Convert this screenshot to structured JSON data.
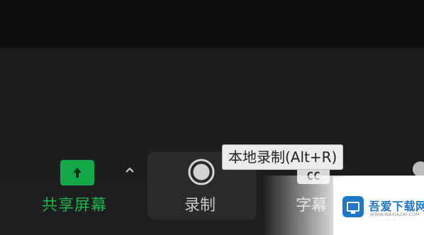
{
  "toolbar": {
    "share_screen": {
      "label": "共享屏幕",
      "icon": "arrow-up-icon",
      "accent": "#13a948"
    },
    "share_options": {
      "icon": "chevron-up-icon"
    },
    "record": {
      "label": "录制",
      "icon": "record-icon"
    },
    "tooltip": {
      "text": "本地录制(Alt+R)"
    },
    "captions": {
      "label": "字幕",
      "icon_text": "CC"
    }
  },
  "watermark": {
    "title": "吾爱下载网",
    "url": "WWW.WAXIAZAI.COM",
    "brand_color": "#1e76c9"
  }
}
